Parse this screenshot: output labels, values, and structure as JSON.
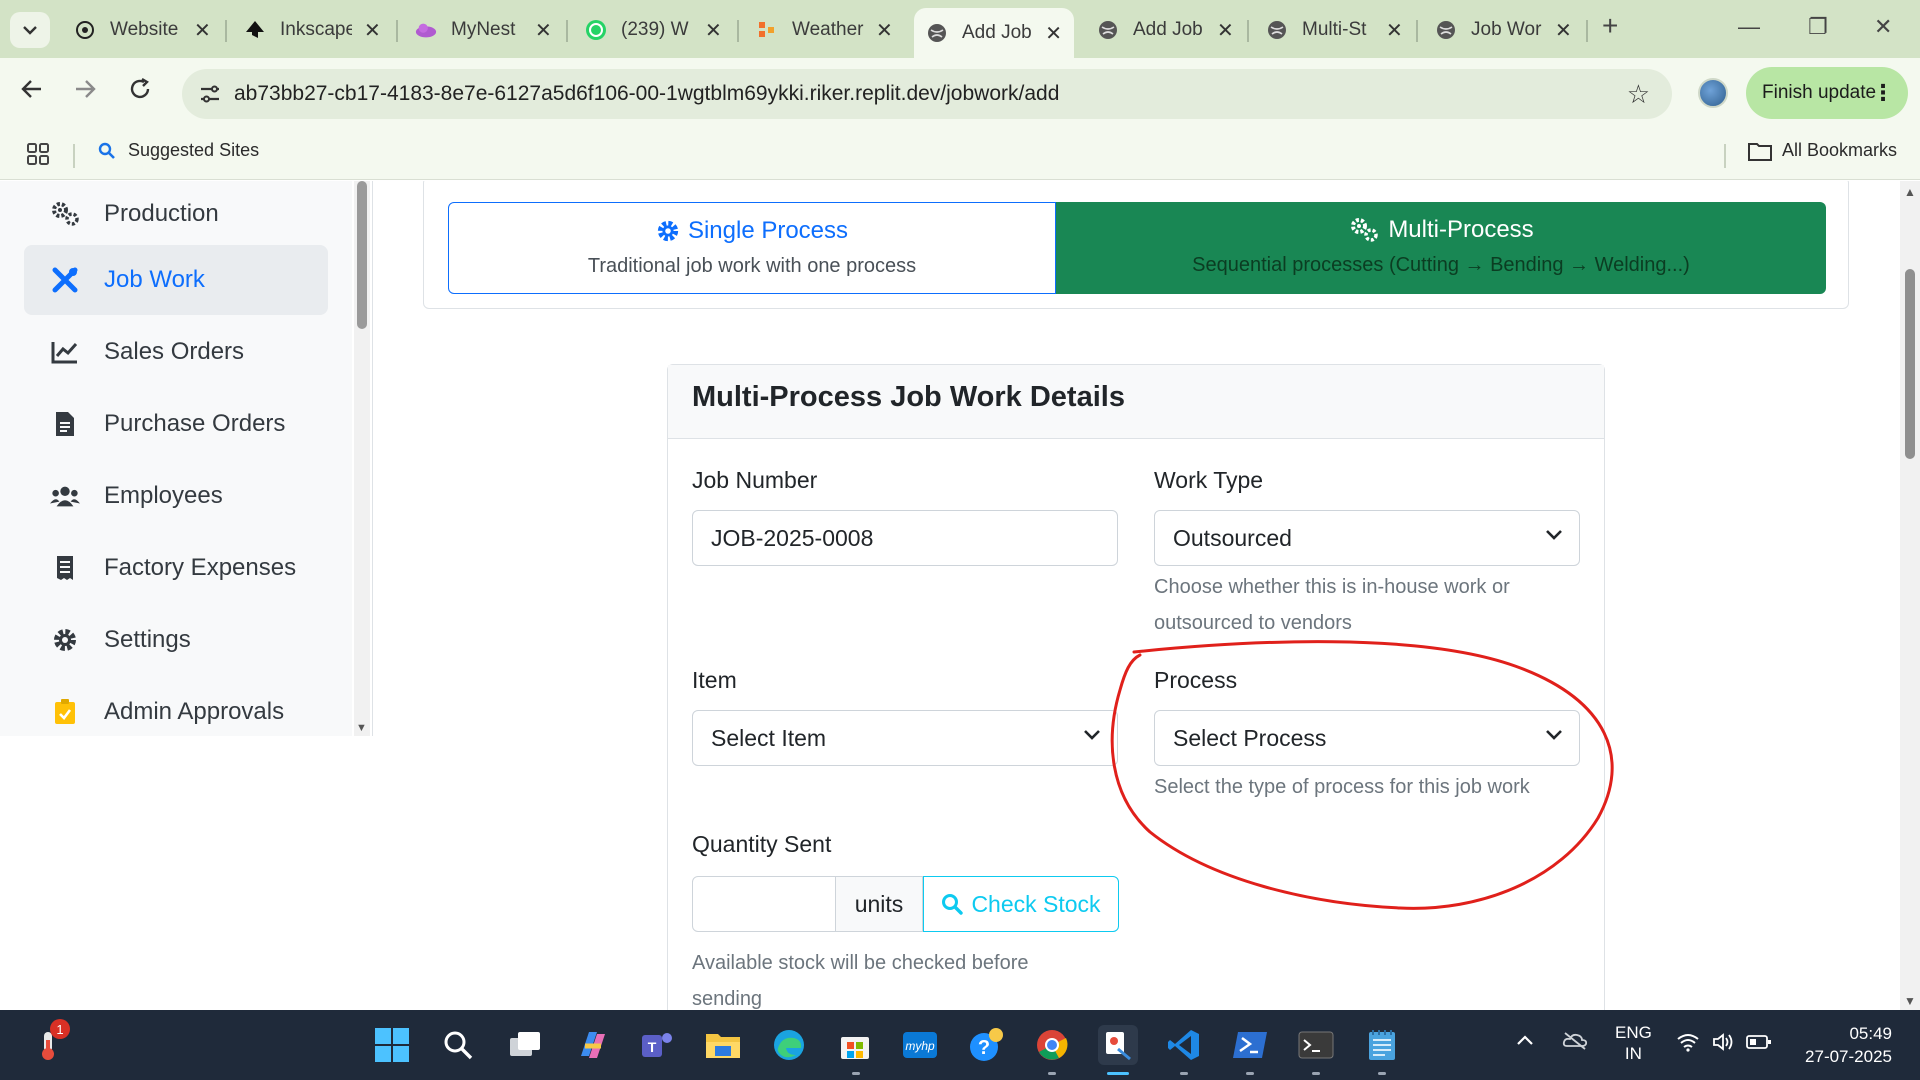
{
  "browser": {
    "tabs": [
      {
        "title": "Website",
        "icon": "openai-icon"
      },
      {
        "title": "Inkscape",
        "icon": "inkscape-icon"
      },
      {
        "title": "MyNest",
        "icon": "cloud-icon"
      },
      {
        "title": "(239) W",
        "icon": "whatsapp-icon"
      },
      {
        "title": "Weather",
        "icon": "weather-icon"
      },
      {
        "title": "Add Job",
        "icon": "globe-icon",
        "active": true
      },
      {
        "title": "Add Job",
        "icon": "globe-icon"
      },
      {
        "title": "Multi-St",
        "icon": "globe-icon"
      },
      {
        "title": "Job Wor",
        "icon": "globe-icon"
      }
    ],
    "url": "ab73bb27-cb17-4183-8e7e-6127a5d6f106-00-1wgtblm69ykki.riker.replit.dev/jobwork/add",
    "finish_update": "Finish update",
    "bookmarks": {
      "suggested": "Suggested Sites",
      "all": "All Bookmarks"
    }
  },
  "sidebar": {
    "items": [
      {
        "label": "Production",
        "icon": "gears-icon"
      },
      {
        "label": "Job Work",
        "icon": "tools-icon",
        "active": true
      },
      {
        "label": "Sales Orders",
        "icon": "chart-line-icon"
      },
      {
        "label": "Purchase Orders",
        "icon": "file-invoice-icon"
      },
      {
        "label": "Employees",
        "icon": "users-icon"
      },
      {
        "label": "Factory Expenses",
        "icon": "receipt-icon"
      },
      {
        "label": "Settings",
        "icon": "cog-icon"
      },
      {
        "label": "Admin Approvals",
        "icon": "clipboard-check-icon"
      }
    ]
  },
  "mode": {
    "single_title": "Single Process",
    "single_sub": "Traditional job work with one process",
    "multi_title": "Multi-Process",
    "multi_sub": "Sequential processes (Cutting → Bending → Welding...)"
  },
  "form": {
    "title": "Multi-Process Job Work Details",
    "job_number_label": "Job Number",
    "job_number_value": "JOB-2025-0008",
    "work_type_label": "Work Type",
    "work_type_value": "Outsourced",
    "work_type_help_1": "Choose whether this is in-house work or",
    "work_type_help_2": "outsourced to vendors",
    "item_label": "Item",
    "item_value": "Select Item",
    "process_label": "Process",
    "process_value": "Select Process",
    "process_help": "Select the type of process for this job work",
    "qty_label": "Quantity Sent",
    "qty_value": "",
    "qty_units": "units",
    "check_stock": "Check Stock",
    "qty_help_1": "Available stock will be checked before",
    "qty_help_2": "sending"
  },
  "taskbar": {
    "lang_1": "ENG",
    "lang_2": "IN",
    "time": "05:49",
    "date": "27-07-2025",
    "notification_count": "1"
  },
  "colors": {
    "primary": "#0d6efd",
    "success": "#198754",
    "info": "#0dcaf0",
    "annotation_red": "#e0201b"
  }
}
